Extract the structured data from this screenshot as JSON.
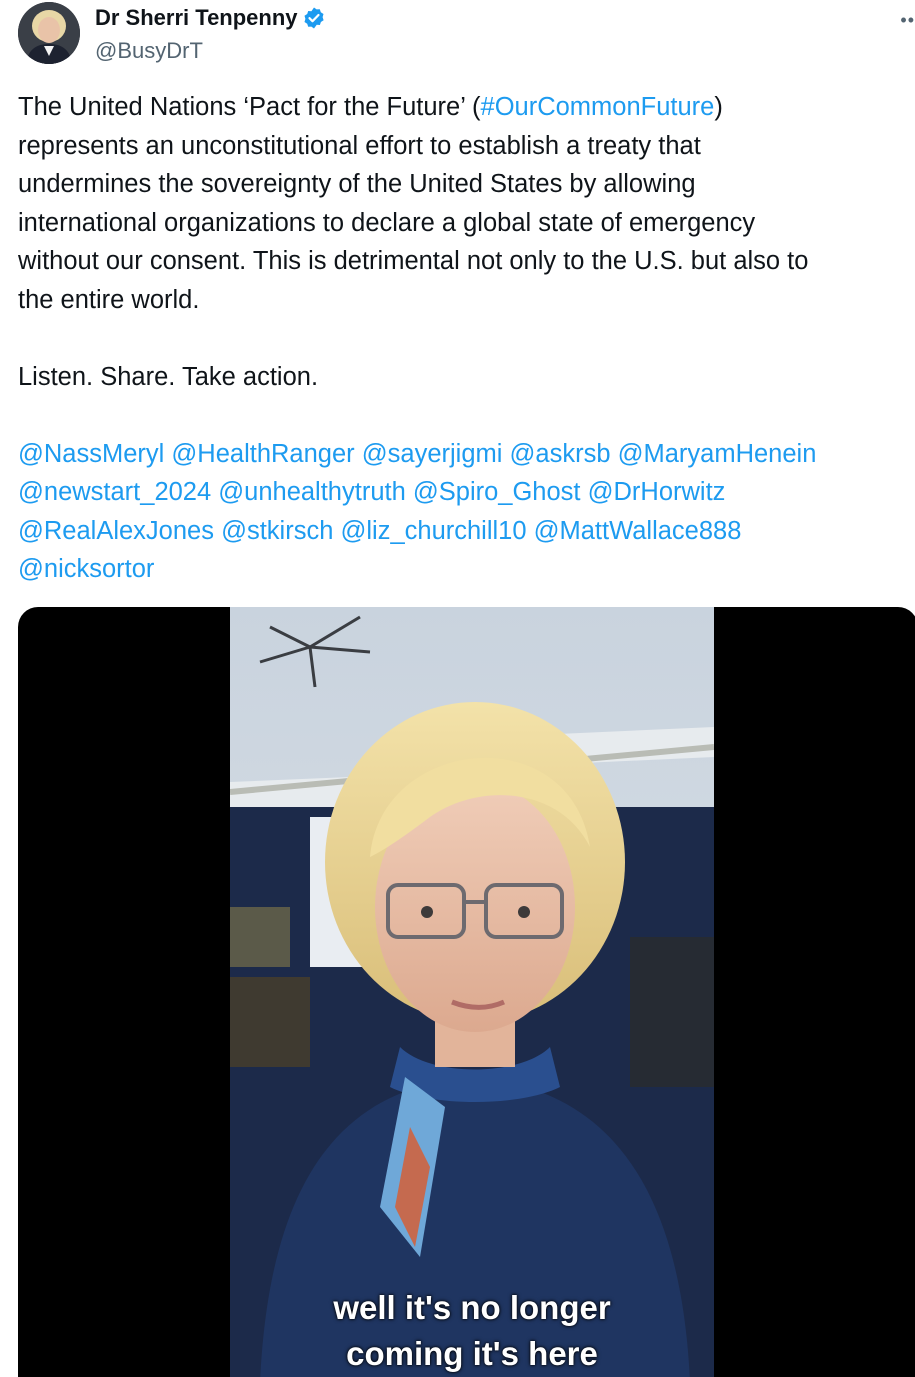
{
  "tweet": {
    "author": {
      "display_name": "Dr Sherri Tenpenny",
      "handle": "@BusyDrT",
      "verified": true
    },
    "more_icon": "more-dots-icon",
    "text_lines": {
      "l1_a": "The United Nations ‘Pact for the Future’ (",
      "l1_hashtag": "#OurCommonFuture",
      "l1_b": ")",
      "l2": "represents an unconstitutional effort to establish a treaty that",
      "l3": "undermines the sovereignty of the United States by allowing",
      "l4": "international organizations to declare a global state of emergency",
      "l5": "without our consent. This is detrimental not only to the U.S. but also to",
      "l6": "the entire world.",
      "l8": "Listen. Share. Take action."
    },
    "mentions": [
      "@NassMeryl",
      "@HealthRanger",
      "@sayerjigmi",
      "@askrsb",
      "@MaryamHenein",
      "@newstart_2024",
      "@unhealthytruth",
      "@Spiro_Ghost",
      "@DrHorwitz",
      "@RealAlexJones",
      "@stkirsch",
      "@liz_churchill10",
      "@MattWallace888",
      "@nicksortor"
    ],
    "video": {
      "caption_line1": "well it's no longer",
      "caption_line2": "coming it's here"
    }
  },
  "colors": {
    "link": "#1d9bf0",
    "text": "#0f1419",
    "secondary": "#536471",
    "verified_badge": "#1d9bf0"
  }
}
